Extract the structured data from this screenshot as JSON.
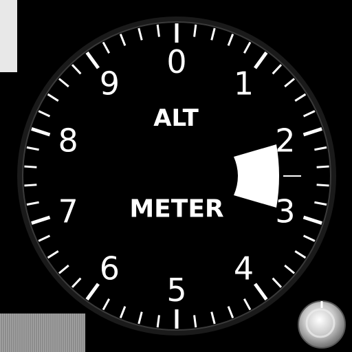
{
  "gauge": {
    "label_top": "ALT",
    "label_bottom": "METER",
    "dial_numbers": [
      "0",
      "1",
      "2",
      "3",
      "4",
      "5",
      "6",
      "7",
      "8",
      "9"
    ],
    "reading": 2.5,
    "major_ticks": 10,
    "minor_per_major": 5,
    "colors": {
      "face": "#000000",
      "markings": "#ffffff",
      "bezel": "#2a2a2a",
      "knob": "#c8c8c8"
    }
  },
  "controls": {
    "adjust_knob_icon": "knob-icon"
  }
}
